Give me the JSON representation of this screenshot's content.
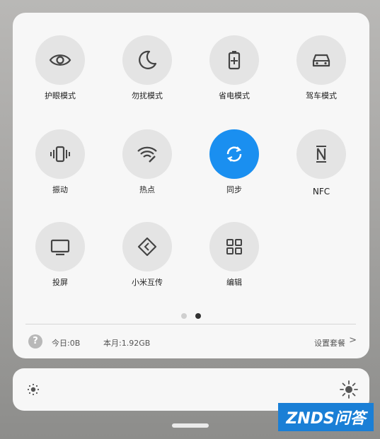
{
  "tiles": [
    {
      "label": "护眼模式",
      "icon": "eye-icon",
      "active": false
    },
    {
      "label": "勿扰模式",
      "icon": "moon-icon",
      "active": false
    },
    {
      "label": "省电模式",
      "icon": "battery-saver-icon",
      "active": false
    },
    {
      "label": "驾车模式",
      "icon": "car-icon",
      "active": false
    },
    {
      "label": "振动",
      "icon": "vibrate-icon",
      "active": false
    },
    {
      "label": "热点",
      "icon": "hotspot-icon",
      "active": false
    },
    {
      "label": "同步",
      "icon": "sync-icon",
      "active": true
    },
    {
      "label": "NFC",
      "icon": "nfc-icon",
      "active": false
    },
    {
      "label": "投屏",
      "icon": "cast-screen-icon",
      "active": false
    },
    {
      "label": "小米互传",
      "icon": "share-transfer-icon",
      "active": false
    },
    {
      "label": "编辑",
      "icon": "edit-grid-icon",
      "active": false
    }
  ],
  "pagination": {
    "total": 2,
    "current": 2
  },
  "footer": {
    "help": "?",
    "today_label": "今日",
    "today_value": ":0B",
    "month_label": "本月",
    "month_value": ":1.92GB",
    "settings_label": "设置套餐",
    "chevron": ">"
  },
  "brightness": {
    "low_icon": "sun-low-icon",
    "high_icon": "sun-high-icon"
  },
  "watermark": "ZNDS问答",
  "colors": {
    "active": "#1a8ff0",
    "tile": "#e4e4e4",
    "panel": "#f7f7f7"
  }
}
